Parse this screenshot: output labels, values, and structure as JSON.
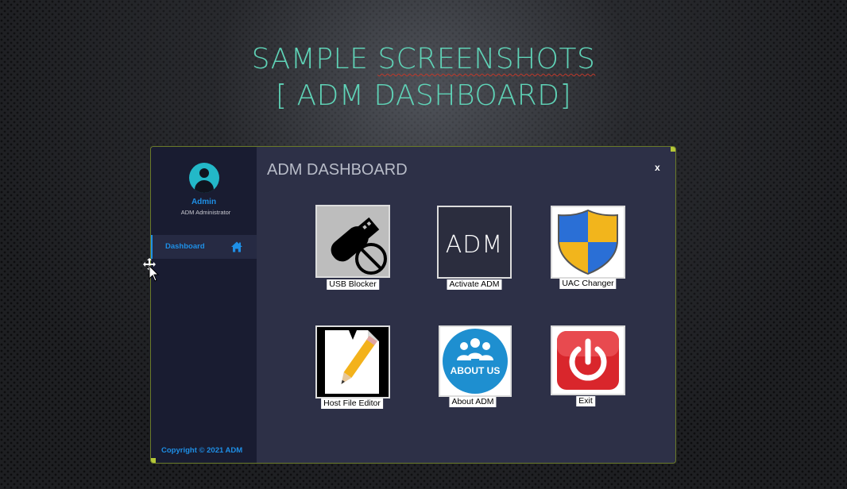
{
  "slide": {
    "title_line1_part1": "SAMPLE",
    "title_line1_part2": "SCREENSHOTS",
    "title_line2": "[ ADM DASHBOARD]"
  },
  "window": {
    "header_title": "ADM DASHBOARD",
    "close_label": "x"
  },
  "sidebar": {
    "user_name": "Admin",
    "user_role": "ADM Administrator",
    "nav_items": [
      {
        "label": "Dashboard",
        "icon": "home-icon"
      }
    ],
    "copyright": "Copyright © 2021 ADM"
  },
  "tiles": [
    {
      "label": "USB Blocker",
      "icon": "usb-blocked-icon"
    },
    {
      "label": "Activate ADM",
      "icon": "adm-logo-icon",
      "logo_text": "ADM"
    },
    {
      "label": "UAC Changer",
      "icon": "uac-shield-icon"
    },
    {
      "label": "Host File Editor",
      "icon": "notepad-pencil-icon"
    },
    {
      "label": "About ADM",
      "icon": "about-us-icon",
      "logo_text": "ABOUT US"
    },
    {
      "label": "Exit",
      "icon": "power-icon"
    }
  ],
  "colors": {
    "accent": "#1e8fe6",
    "title_teal": "#5fd3b7",
    "sidebar_bg": "#191c31",
    "content_bg": "#2d3047"
  }
}
